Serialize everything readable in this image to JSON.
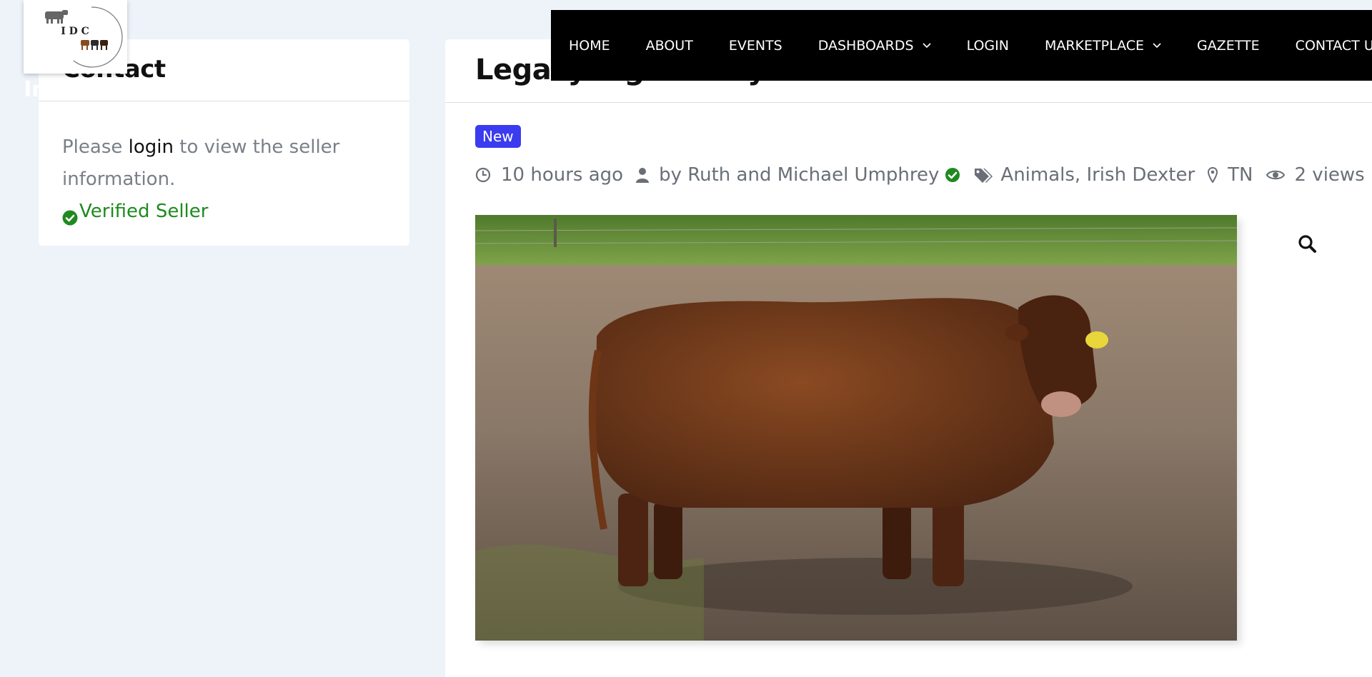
{
  "site": {
    "logo_text": "I D C",
    "hero_fragment": "In"
  },
  "nav": {
    "items": [
      {
        "label": "HOME",
        "has_dropdown": false
      },
      {
        "label": "ABOUT",
        "has_dropdown": false
      },
      {
        "label": "EVENTS",
        "has_dropdown": false
      },
      {
        "label": "DASHBOARDS",
        "has_dropdown": true
      },
      {
        "label": "LOGIN",
        "has_dropdown": false
      },
      {
        "label": "MARKETPLACE",
        "has_dropdown": true
      },
      {
        "label": "GAZETTE",
        "has_dropdown": false
      },
      {
        "label": "CONTACT US",
        "has_dropdown": false
      }
    ],
    "chevron_icon": "chevron-down-icon"
  },
  "sidebar": {
    "contact_title": "Contact",
    "please_text": "Please ",
    "login_link": "login",
    "after_login_text": " to view the seller information.",
    "verified_label": "Verified Seller",
    "verified_icon": "check-circle-icon",
    "verified_color": "#1f8a1f"
  },
  "listing": {
    "title": "Legacy Eight . . . y",
    "badge": "New",
    "badge_color": "#3b3bf0",
    "posted_ago": "10 hours ago",
    "author": "by Ruth and Michael Umphrey",
    "categories": "Animals, Irish Dexter",
    "location": "TN",
    "views": "2 views",
    "icons": {
      "time": "clock-icon",
      "author": "user-icon",
      "verified": "check-circle-icon",
      "categories": "tags-icon",
      "location": "map-marker-icon",
      "views": "eye-icon",
      "zoom": "search-icon"
    }
  }
}
